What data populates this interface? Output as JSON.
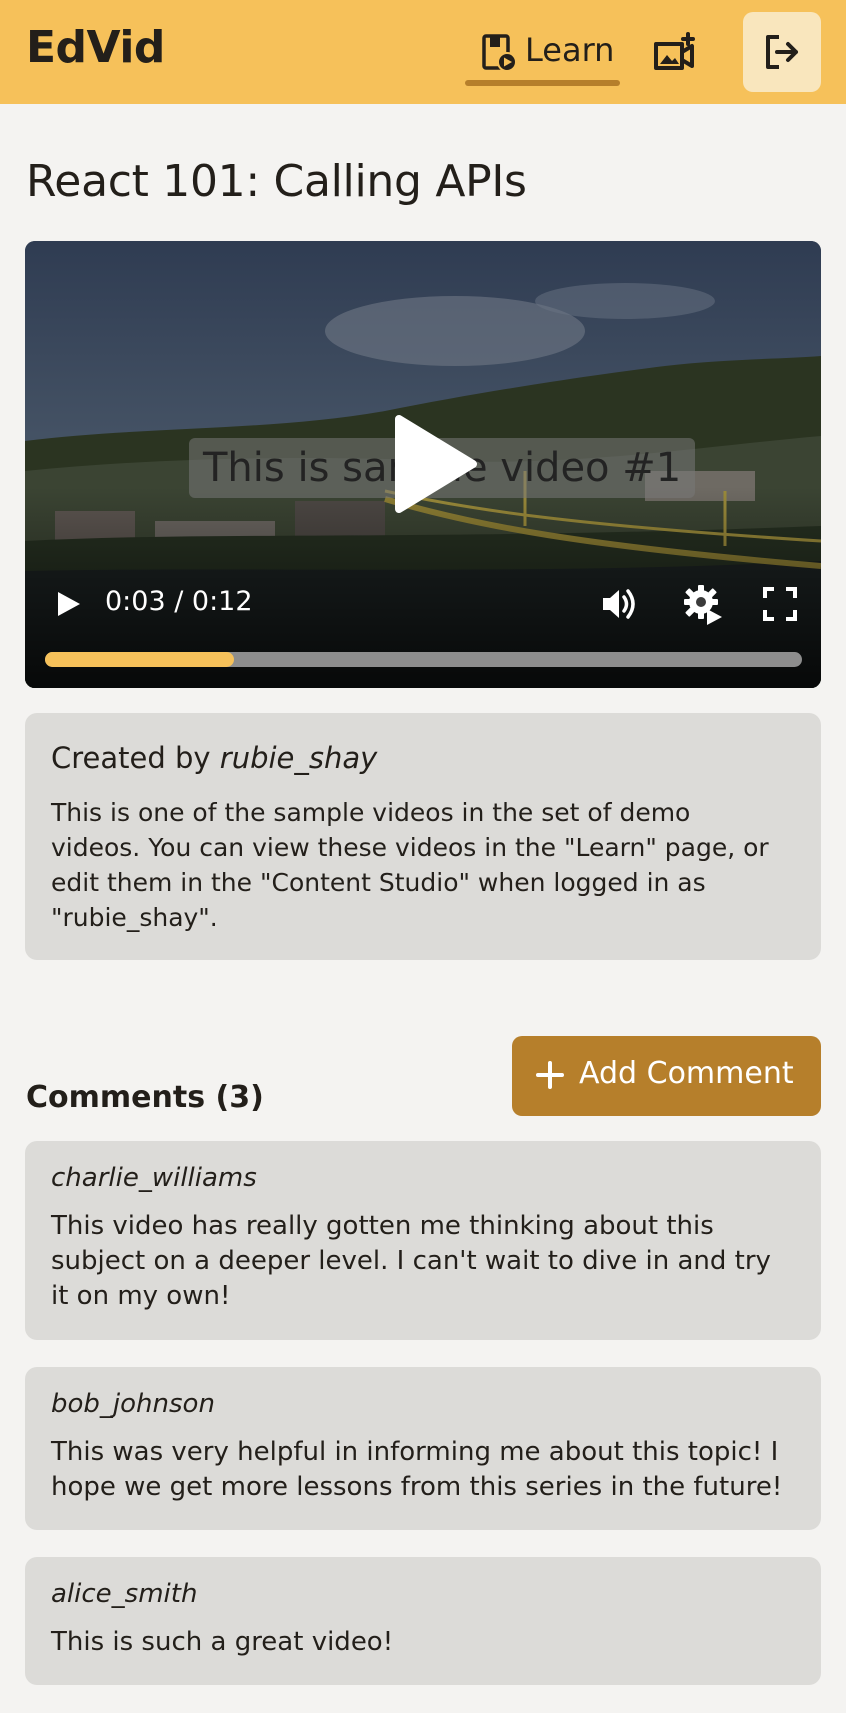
{
  "nav": {
    "brand": "EdVid",
    "learn_label": "Learn",
    "learn_icon": "video-library-icon",
    "studio_icon": "video-camera-icon",
    "logout_icon": "logout-icon",
    "accent": "#f6c15a",
    "active_underline": "#b67f2b"
  },
  "video": {
    "title": "React 101: Calling APIs",
    "caption": "This is sample video #1",
    "time": "0:03 / 0:12",
    "progress": 0.25,
    "progress_color": "#f6c15a"
  },
  "info": {
    "created_prefix": "Created by ",
    "creator": "rubie_shay",
    "description": "This is one of the sample videos in the set of demo videos. You can view these videos in the \"Learn\" page, or edit them in the \"Content Studio\" when logged in as \"rubie_shay\"."
  },
  "comments": {
    "heading": "Comments (3)",
    "add_label": "Add Comment",
    "button_color": "#b67f2b",
    "items": [
      {
        "author": "charlie_williams",
        "text": "This video has really gotten me thinking about this subject on a deeper level. I can't wait to dive in and try it on my own!"
      },
      {
        "author": "bob_johnson",
        "text": "This was very helpful in informing me about this topic! I hope we get more lessons from this series in the future!"
      },
      {
        "author": "alice_smith",
        "text": "This is such a great video!"
      }
    ]
  }
}
